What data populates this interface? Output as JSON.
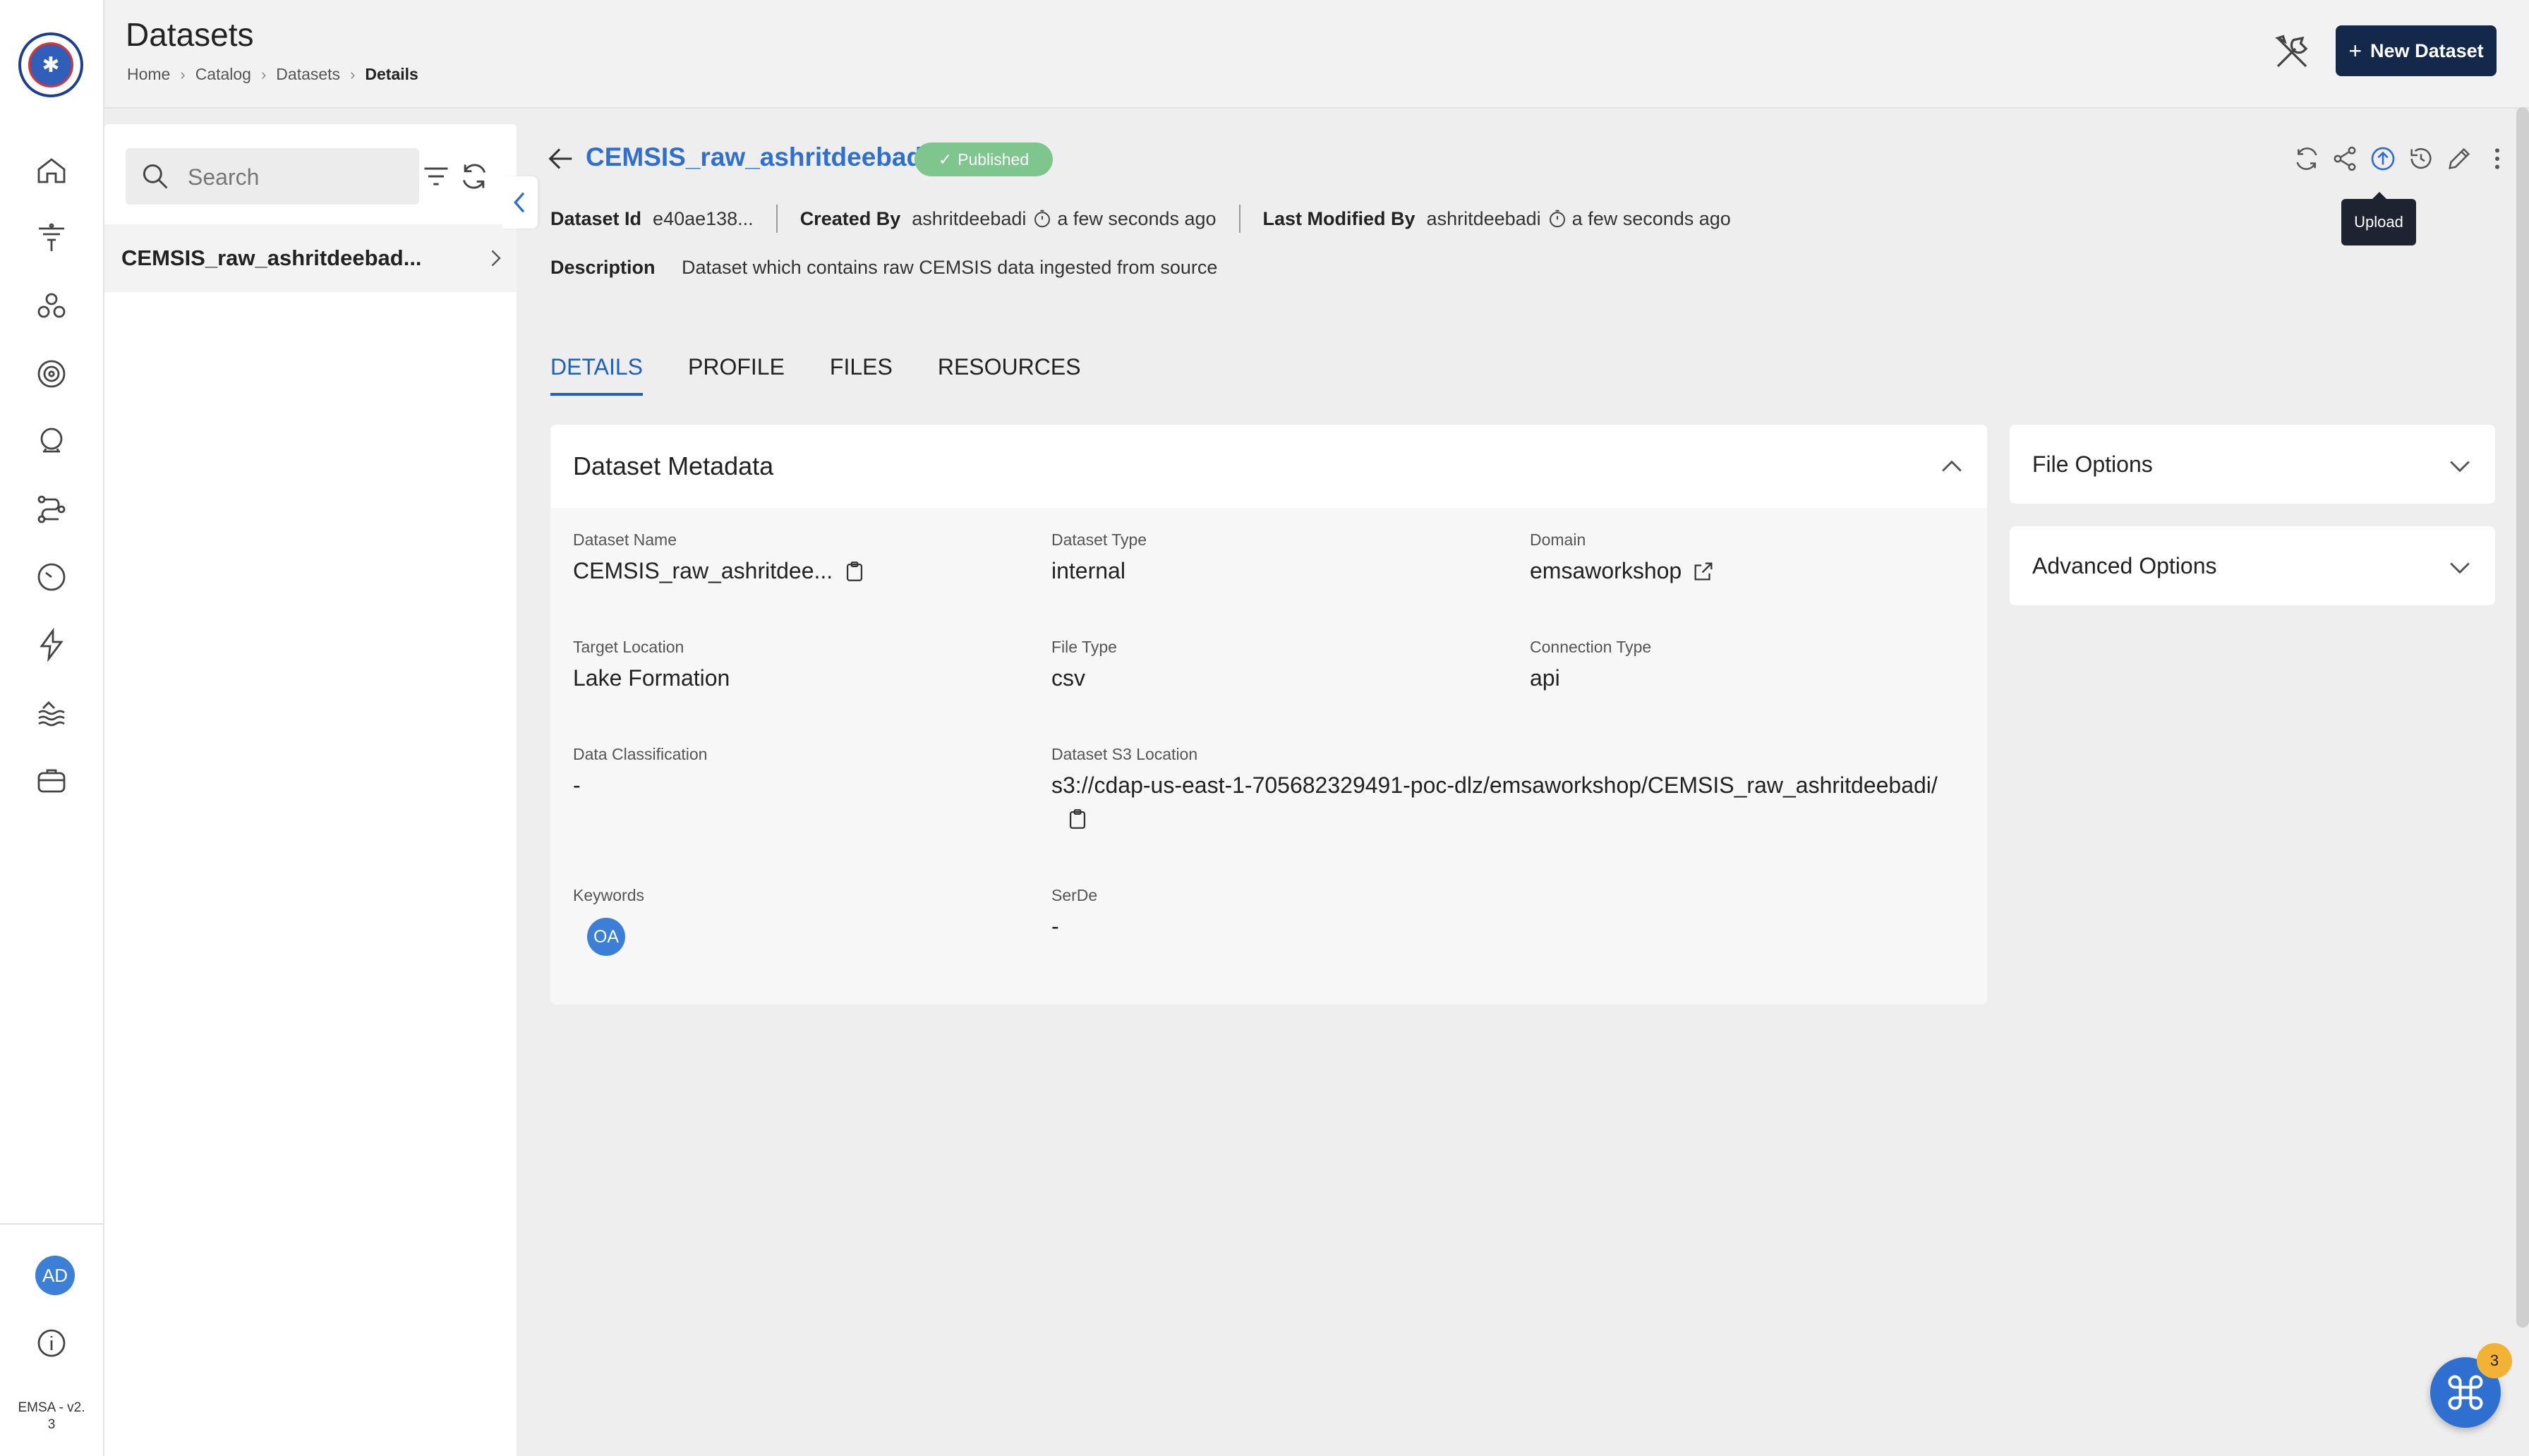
{
  "app": {
    "version_label": "EMSA - v2.\n3",
    "user_initials": "AD"
  },
  "header": {
    "title": "Datasets",
    "breadcrumb": [
      "Home",
      "Catalog",
      "Datasets",
      "Details"
    ],
    "new_button_label": "New Dataset",
    "new_button_icon": "plus-icon",
    "tools_icon": "tools-icon"
  },
  "list": {
    "search_placeholder": "Search",
    "items": [
      {
        "label": "CEMSIS_raw_ashritdeebad..."
      }
    ]
  },
  "dataset": {
    "title": "CEMSIS_raw_ashritdeebadi",
    "status": "Published",
    "id_label": "Dataset Id",
    "id_value": "e40ae138...",
    "created_by_label": "Created By",
    "created_by": "ashritdeebadi",
    "created_time": "a few seconds ago",
    "modified_by_label": "Last Modified By",
    "modified_by": "ashritdeebadi",
    "modified_time": "a few seconds ago",
    "description_label": "Description",
    "description": "Dataset which contains raw CEMSIS data ingested from source",
    "tooltip": "Upload"
  },
  "tabs": [
    "DETAILS",
    "PROFILE",
    "FILES",
    "RESOURCES"
  ],
  "metadata": {
    "title": "Dataset Metadata",
    "fields": {
      "dataset_name": {
        "label": "Dataset Name",
        "value": "CEMSIS_raw_ashritdee..."
      },
      "dataset_type": {
        "label": "Dataset Type",
        "value": "internal"
      },
      "domain": {
        "label": "Domain",
        "value": "emsaworkshop"
      },
      "target_location": {
        "label": "Target Location",
        "value": "Lake Formation"
      },
      "file_type": {
        "label": "File Type",
        "value": "csv"
      },
      "connection_type": {
        "label": "Connection Type",
        "value": "api"
      },
      "data_classification": {
        "label": "Data Classification",
        "value": "-"
      },
      "s3_location": {
        "label": "Dataset S3 Location",
        "value": "s3://cdap-us-east-1-705682329491-poc-dlz/emsaworkshop/CEMSIS_raw_ashritdeebadi/"
      },
      "keywords": {
        "label": "Keywords",
        "value": "OA"
      },
      "serde": {
        "label": "SerDe",
        "value": "-"
      }
    }
  },
  "options": {
    "file_options": "File Options",
    "advanced_options": "Advanced Options"
  },
  "fab": {
    "badge_count": "3"
  },
  "colors": {
    "accent": "#2f6fcf",
    "primary_button": "#14284b",
    "published_badge": "#7ec68e",
    "notification_badge": "#f2b233"
  }
}
